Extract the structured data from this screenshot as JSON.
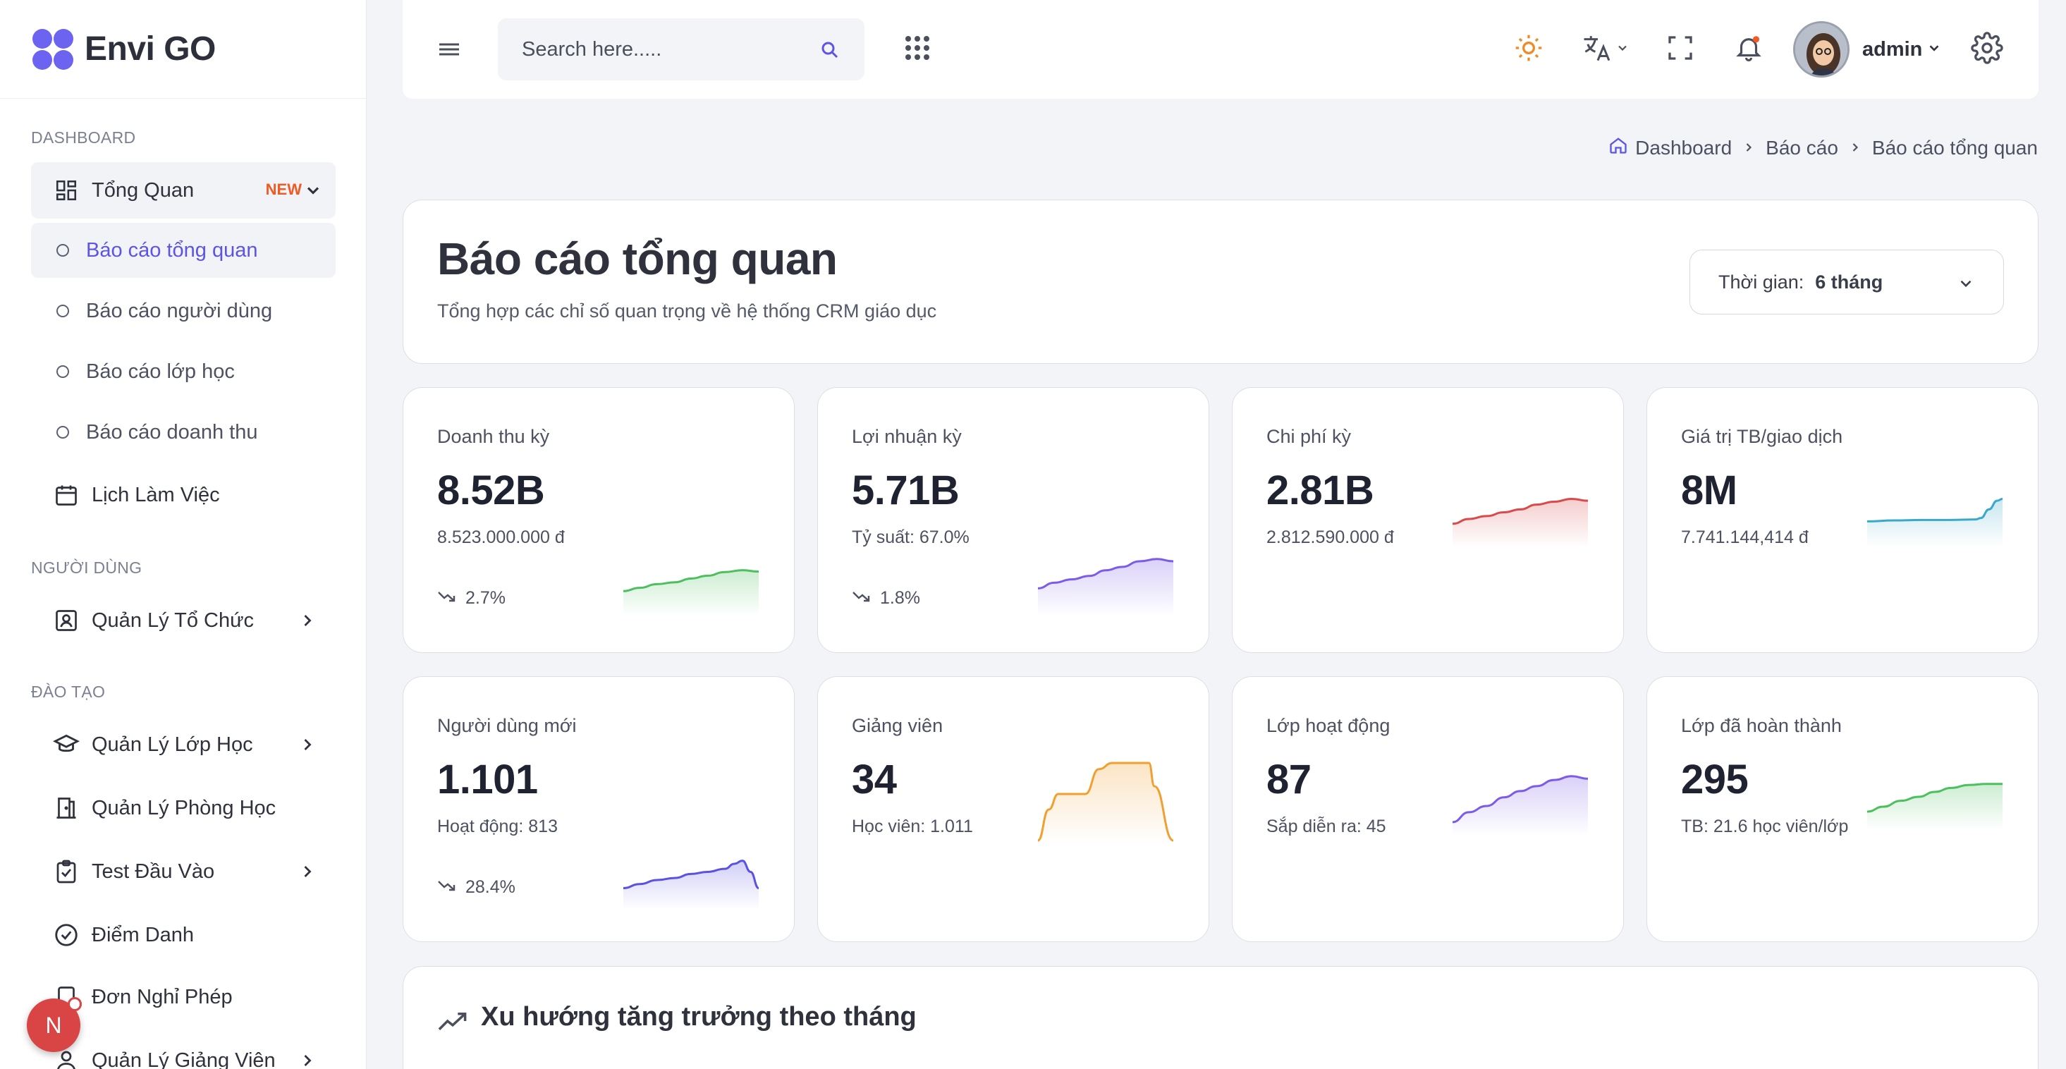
{
  "brand": {
    "name": "Envi GO"
  },
  "sidebar": {
    "sections": {
      "dashboard": "DASHBOARD",
      "users": "NGƯỜI DÙNG",
      "training": "ĐÀO TẠO"
    },
    "overview": {
      "label": "Tổng Quan",
      "badge": "NEW"
    },
    "sub_items": [
      "Báo cáo tổng quan",
      "Báo cáo người dùng",
      "Báo cáo lớp học",
      "Báo cáo doanh thu"
    ],
    "items": {
      "calendar": "Lịch Làm Việc",
      "org": "Quản Lý Tổ Chức",
      "classes": "Quản Lý Lớp Học",
      "rooms": "Quản Lý Phòng Học",
      "test": "Test Đầu Vào",
      "attendance": "Điểm Danh",
      "leave": "Đơn Nghỉ Phép",
      "teachers": "Quản Lý Giảng Viên"
    }
  },
  "fab": {
    "letter": "N"
  },
  "topbar": {
    "search_placeholder": "Search here.....",
    "username": "admin"
  },
  "breadcrumb": [
    "Dashboard",
    "Báo cáo",
    "Báo cáo tổng quan"
  ],
  "header": {
    "title": "Báo cáo tổng quan",
    "subtitle": "Tổng hợp các chỉ số quan trọng về hệ thống CRM giáo dục",
    "time_label": "Thời gian:",
    "time_value": "6 tháng"
  },
  "stats": [
    {
      "label": "Doanh thu kỳ",
      "value": "8.52B",
      "sub": "8.523.000.000 đ",
      "trend": "2.7%",
      "color": "#4cbf5e"
    },
    {
      "label": "Lợi nhuận kỳ",
      "value": "5.71B",
      "sub": "Tỷ suất: 67.0%",
      "trend": "1.8%",
      "color": "#7b5be8"
    },
    {
      "label": "Chi phí kỳ",
      "value": "2.81B",
      "sub": "2.812.590.000 đ",
      "trend": "",
      "color": "#d94a4a"
    },
    {
      "label": "Giá trị TB/giao dịch",
      "value": "8M",
      "sub": "7.741.144,414 đ",
      "trend": "",
      "color": "#3aa8c9"
    },
    {
      "label": "Người dùng mới",
      "value": "1.101",
      "sub": "Hoạt động: 813",
      "trend": "28.4%",
      "color": "#5a52e0"
    },
    {
      "label": "Giảng viên",
      "value": "34",
      "sub": "Học viên: 1.011",
      "trend": "",
      "color": "#f0a030"
    },
    {
      "label": "Lớp hoạt động",
      "value": "87",
      "sub": "Sắp diễn ra: 45",
      "trend": "",
      "color": "#7b5be8"
    },
    {
      "label": "Lớp đã hoàn thành",
      "value": "295",
      "sub": "TB: 21.6 học viên/lớp",
      "trend": "",
      "color": "#4cbf5e"
    }
  ],
  "growth": {
    "title": "Xu hướng tăng trưởng theo tháng"
  },
  "icons": [
    "menu-icon",
    "search-icon",
    "apps-icon",
    "sun-icon",
    "translate-icon",
    "fullscreen-icon",
    "bell-icon",
    "settings-icon",
    "home-icon",
    "chevron-right-icon",
    "trend-down-icon",
    "trend-up-icon"
  ]
}
